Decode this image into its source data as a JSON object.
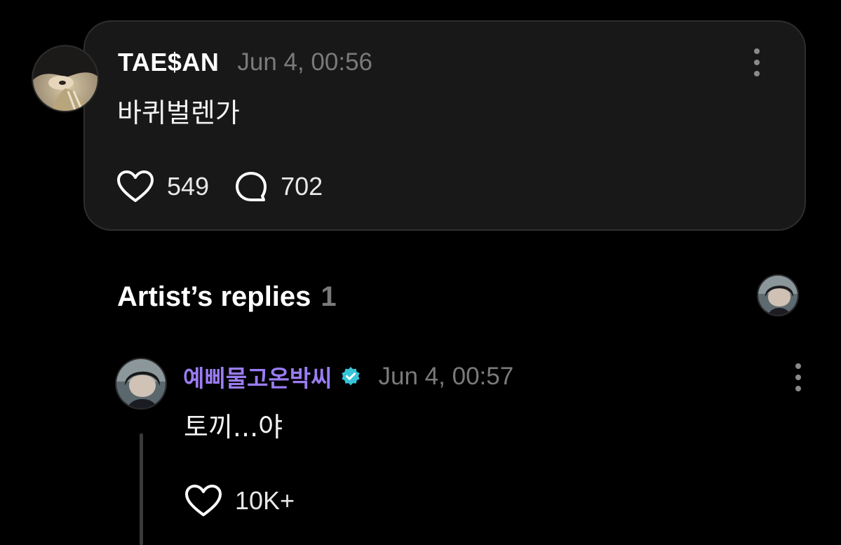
{
  "post": {
    "author": "TAE$AN",
    "timestamp": "Jun 4, 00:56",
    "body": "바퀴벌렌가",
    "likes": "549",
    "comments": "702"
  },
  "artist_replies": {
    "title": "Artist’s replies",
    "count": "1"
  },
  "reply": {
    "author": "예삐물고온박씨",
    "verified": true,
    "timestamp": "Jun 4, 00:57",
    "body": "토끼...야",
    "likes": "10K+"
  },
  "icons": {
    "more": "kebab-icon",
    "like": "heart-outline-icon",
    "comment": "speech-bubble-icon",
    "verified": "verified-check-icon"
  },
  "colors": {
    "background": "#000000",
    "card": "#181818",
    "artist_name": "#9a7cf2",
    "verified_badge": "#35c4d8",
    "muted_text": "#7a7a7a"
  }
}
